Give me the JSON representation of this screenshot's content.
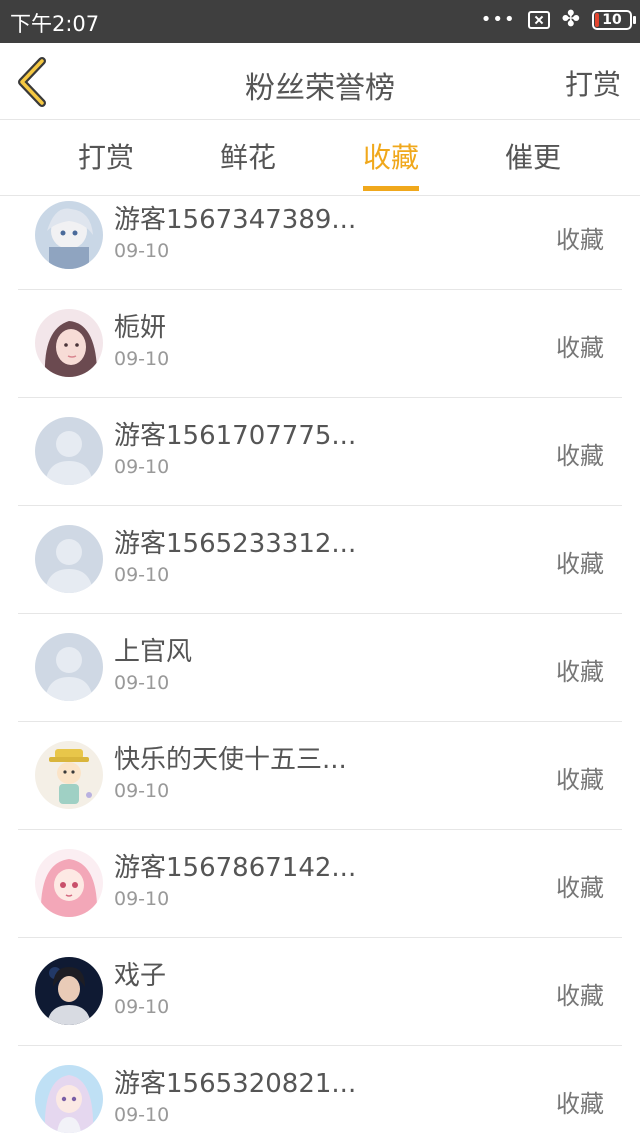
{
  "status_bar": {
    "time": "下午2:07",
    "dots": "•••",
    "battery": "10",
    "battery_level_percent": 10,
    "icons": [
      "more-dots-icon",
      "close-box-icon",
      "clover-icon",
      "battery-icon"
    ]
  },
  "header": {
    "back_icon": "chevron-left-icon",
    "title": "粉丝荣誉榜",
    "action_label": "打赏"
  },
  "colors": {
    "accent": "#f0a81c",
    "text": "#555555",
    "subtle": "#999999",
    "divider": "#e6e6e6",
    "status_bar": "#3f3f3f"
  },
  "tabs": [
    {
      "label": "打赏",
      "active": false
    },
    {
      "label": "鲜花",
      "active": false
    },
    {
      "label": "收藏",
      "active": true
    },
    {
      "label": "催更",
      "active": false
    }
  ],
  "list": [
    {
      "name": "游客1567347389...",
      "date": "09-10",
      "action": "收藏",
      "avatar": "anime-white-hair"
    },
    {
      "name": "栀妍",
      "date": "09-10",
      "action": "收藏",
      "avatar": "girl-pink"
    },
    {
      "name": "游客1561707775...",
      "date": "09-10",
      "action": "收藏",
      "avatar": "default-person"
    },
    {
      "name": "游客1565233312...",
      "date": "09-10",
      "action": "收藏",
      "avatar": "default-person"
    },
    {
      "name": "上官风",
      "date": "09-10",
      "action": "收藏",
      "avatar": "default-person"
    },
    {
      "name": "快乐的天使十五三...",
      "date": "09-10",
      "action": "收藏",
      "avatar": "cartoon-yellow-hat"
    },
    {
      "name": "游客1567867142...",
      "date": "09-10",
      "action": "收藏",
      "avatar": "anime-pink-hair"
    },
    {
      "name": "戏子",
      "date": "09-10",
      "action": "收藏",
      "avatar": "dark-portrait"
    },
    {
      "name": "游客1565320821...",
      "date": "09-10",
      "action": "收藏",
      "avatar": "anime-lavender-hair"
    }
  ]
}
